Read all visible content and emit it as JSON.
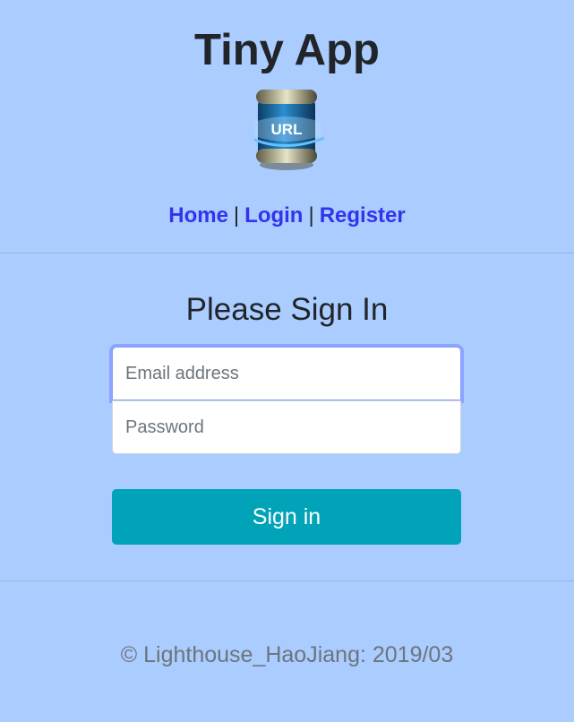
{
  "header": {
    "title": "Tiny App",
    "logo_text": "URL",
    "logo_icon": "url-barrel-logo"
  },
  "nav": {
    "items": [
      {
        "label": "Home"
      },
      {
        "label": "Login"
      },
      {
        "label": "Register"
      }
    ],
    "separator": "|"
  },
  "signin_form": {
    "heading": "Please Sign In",
    "email_placeholder": "Email address",
    "email_value": "",
    "password_placeholder": "Password",
    "password_value": "",
    "submit_label": "Sign in"
  },
  "footer": {
    "text": "© Lighthouse_HaoJiang: 2019/03"
  },
  "colors": {
    "background": "#aaccff",
    "link": "#3333ee",
    "button": "#00a3b8",
    "focus_ring": "#8fa3ff"
  }
}
